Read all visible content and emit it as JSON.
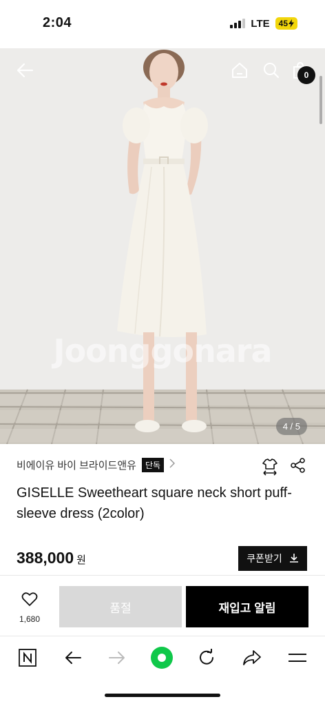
{
  "status_bar": {
    "time": "2:04",
    "network": "LTE",
    "battery": "45"
  },
  "hero": {
    "watermark": "Joonggonara",
    "image_counter": "4 / 5"
  },
  "header": {
    "cart_count": "0",
    "icons": [
      "back-arrow-icon",
      "home-icon",
      "search-icon",
      "shopping-bag-icon"
    ]
  },
  "product": {
    "brand": "비에이유 바이 브라이드앤유",
    "brand_badge": "단독",
    "title": "GISELLE Sweetheart square neck short puff-sleeve dress (2color)",
    "price": "388,000",
    "price_unit": "원",
    "coupon_label": "쿠폰받기"
  },
  "actions": {
    "like_count": "1,680",
    "soldout_label": "품절",
    "restock_label": "재입고 알림"
  },
  "browser": {
    "icons": [
      "naver-n-icon",
      "back-icon",
      "forward-icon",
      "green-dot-icon",
      "refresh-icon",
      "share-icon",
      "menu-icon"
    ]
  },
  "colors": {
    "accent_green": "#10c84a",
    "primary_black": "#000000",
    "disabled_gray": "#d9d9d9",
    "battery_yellow": "#f2d60b"
  }
}
